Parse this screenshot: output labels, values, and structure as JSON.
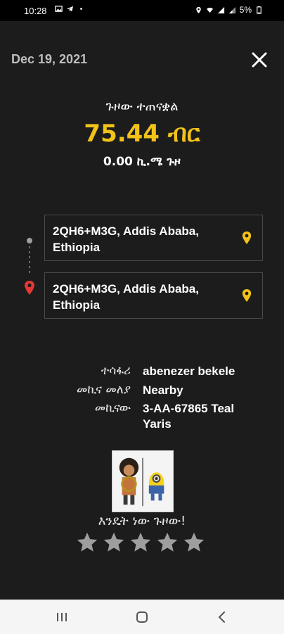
{
  "status_bar": {
    "time": "10:28",
    "battery": "5%",
    "icons_left": [
      "gallery-icon",
      "telegram-icon",
      "dot-icon"
    ],
    "icons_right": [
      "location-icon",
      "wifi-icon",
      "signal-icon",
      "signal-icon",
      "battery-icon"
    ]
  },
  "header": {
    "date": "Dec 19, 2021"
  },
  "trip": {
    "title": "ጉዞው ተጠናቋል",
    "fare": "75.44 ብር",
    "distance": "0.00 ኪ.ሜ ጉዞ"
  },
  "route": {
    "pickup": "2QH6+M3G, Addis Ababa, Ethiopia",
    "dropoff": "2QH6+M3G, Addis Ababa, Ethiopia"
  },
  "details": {
    "passenger_label": "ተሳፋሪ",
    "passenger_value": "abenezer bekele",
    "vehicle_type_label": "መኪና መለያ",
    "vehicle_type_value": "Nearby",
    "vehicle_label": "መኪናው",
    "vehicle_value": "3-AA-67865 Teal Yaris"
  },
  "rating": {
    "prompt": "እንዴት ነው ጉዞው!",
    "stars": 5,
    "selected": 0
  },
  "colors": {
    "accent": "#f2c218",
    "background": "#1c1c1c",
    "pin_red": "#e53935"
  }
}
